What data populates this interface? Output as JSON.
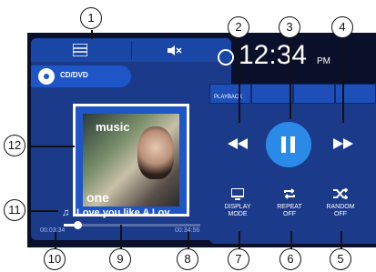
{
  "clock": {
    "time": "12:34",
    "period": "PM"
  },
  "source": {
    "label": "CD/DVD"
  },
  "tab": {
    "label": "PLAYBACK"
  },
  "song": {
    "title": "Love you like A Lov...",
    "elapsed": "00:03:34",
    "total": "00:34:56",
    "progress": 0.1
  },
  "album": {
    "line1": "music",
    "line2": "one"
  },
  "controls": {
    "display": {
      "line1": "DISPLAY",
      "line2": "MODE"
    },
    "repeat": {
      "line1": "REPEAT",
      "line2": "OFF"
    },
    "random": {
      "line1": "RANDOM",
      "line2": "OFF"
    }
  },
  "callouts": [
    "1",
    "2",
    "3",
    "4",
    "5",
    "6",
    "7",
    "8",
    "9",
    "10",
    "11",
    "12"
  ]
}
